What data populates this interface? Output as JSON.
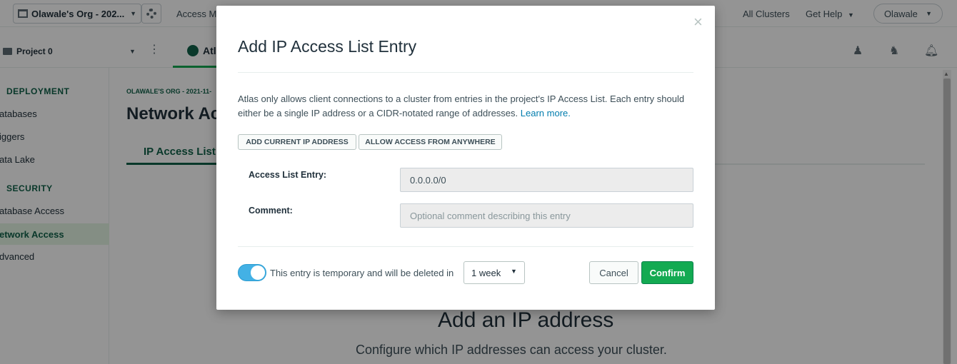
{
  "topbar": {
    "org_name": "Olawale's Org - 202...",
    "access_manager": "Access M",
    "all_clusters": "All Clusters",
    "get_help": "Get Help",
    "user": "Olawale"
  },
  "navbar": {
    "project": "Project 0",
    "atlas_tab": "Atl"
  },
  "sidebar": {
    "deployment_heading": "DEPLOYMENT",
    "deployment_items": [
      "atabases",
      "iggers",
      "ata Lake"
    ],
    "security_heading": "SECURITY",
    "security_items": [
      "atabase Access",
      "etwork Access",
      "dvanced"
    ],
    "active_item": "etwork Access"
  },
  "main": {
    "breadcrumb": "OLAWALE'S ORG - 2021-11-",
    "title": "Network Ac",
    "tab_ip": "IP Access List",
    "empty_title": "Add an IP address",
    "empty_subtitle": "Configure which IP addresses can access your cluster."
  },
  "modal": {
    "title": "Add IP Access List Entry",
    "close": "×",
    "description": "Atlas only allows client connections to a cluster from entries in the project's IP Access List. Each entry should either be a single IP address or a CIDR-notated range of addresses.",
    "learn_more": "Learn more.",
    "add_current_ip": "ADD CURRENT IP ADDRESS",
    "allow_anywhere": "ALLOW ACCESS FROM ANYWHERE",
    "entry_label": "Access List Entry:",
    "entry_value": "0.0.0.0/0",
    "comment_label": "Comment:",
    "comment_placeholder": "Optional comment describing this entry",
    "temporary_enabled": true,
    "temporary_text": "This entry is temporary and will be deleted in",
    "duration": "1 week",
    "cancel": "Cancel",
    "confirm": "Confirm"
  },
  "colors": {
    "accent_green": "#13aa52",
    "dark_green": "#116149",
    "toggle_blue": "#43b1e5",
    "link_blue": "#007cad"
  }
}
